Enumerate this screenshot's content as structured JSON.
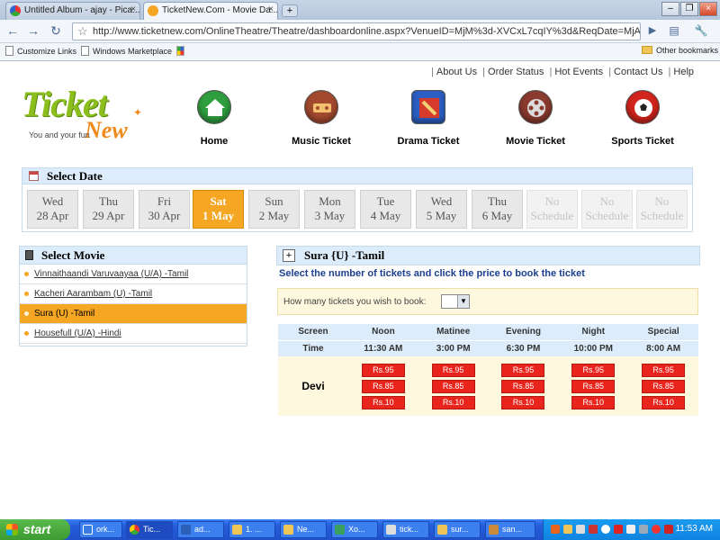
{
  "browser": {
    "tabs": [
      {
        "label": "Untitled Album - ajay - Pica...",
        "active": false
      },
      {
        "label": "TicketNew.Com - Movie Da...",
        "active": true
      }
    ],
    "new_tab": "+",
    "url": "http://www.ticketnew.com/OnlineTheatre/Theatre/dashboardonline.aspx?VenueID=MjM%3d-XVCxL7cqIY%3d&ReqDate=MjA>",
    "bookmarks": [
      "Customize Links",
      "Windows Marketplace"
    ],
    "other_bookmarks": "Other bookmarks"
  },
  "site": {
    "top_links": [
      "About Us",
      "Order Status",
      "Hot Events",
      "Contact Us",
      "Help"
    ],
    "logo_text": "Ticket",
    "logo_sub": "New",
    "tagline": "You and your fun",
    "categories": [
      {
        "label": "Home",
        "icon": "home-icon",
        "color": "#2e9e3e"
      },
      {
        "label": "Music Ticket",
        "icon": "music-icon",
        "color": "#a34a2e"
      },
      {
        "label": "Drama Ticket",
        "icon": "drama-icon",
        "color": "#2c5fc4"
      },
      {
        "label": "Movie Ticket",
        "icon": "film-reel-icon",
        "color": "#8a3a2e"
      },
      {
        "label": "Sports Ticket",
        "icon": "football-icon",
        "color": "#d0241c"
      }
    ]
  },
  "select_date": {
    "title": "Select Date",
    "days": [
      {
        "day": "Wed",
        "date": "28 Apr",
        "state": "normal"
      },
      {
        "day": "Thu",
        "date": "29 Apr",
        "state": "normal"
      },
      {
        "day": "Fri",
        "date": "30 Apr",
        "state": "normal"
      },
      {
        "day": "Sat",
        "date": "1 May",
        "state": "selected"
      },
      {
        "day": "Sun",
        "date": "2 May",
        "state": "normal"
      },
      {
        "day": "Mon",
        "date": "3 May",
        "state": "normal"
      },
      {
        "day": "Tue",
        "date": "4 May",
        "state": "normal"
      },
      {
        "day": "Wed",
        "date": "5 May",
        "state": "normal"
      },
      {
        "day": "Thu",
        "date": "6 May",
        "state": "normal"
      },
      {
        "day": "No",
        "date": "Schedule",
        "state": "disabled"
      },
      {
        "day": "No",
        "date": "Schedule",
        "state": "disabled"
      },
      {
        "day": "No",
        "date": "Schedule",
        "state": "disabled"
      }
    ]
  },
  "select_movie": {
    "title": "Select Movie",
    "movies": [
      {
        "label": "Vinnaithaandi Varuvaayaa (U/A) -Tamil",
        "selected": false
      },
      {
        "label": "Kacheri Aarambam (U) -Tamil",
        "selected": false
      },
      {
        "label": "Sura (U) -Tamil",
        "selected": true
      },
      {
        "label": "Housefull (U/A) -Hindi",
        "selected": false
      }
    ]
  },
  "booking": {
    "movie_title": "Sura {U} -Tamil",
    "expand_symbol": "+",
    "instruction": "Select the number of tickets and click the price to book the ticket",
    "tickets_label": "How many tickets you wish to book:",
    "tickets_value": "",
    "screen_header": "Screen",
    "time_header": "Time",
    "shows": [
      {
        "name": "Noon",
        "time": "11:30 AM"
      },
      {
        "name": "Matinee",
        "time": "3:00 PM"
      },
      {
        "name": "Evening",
        "time": "6:30 PM"
      },
      {
        "name": "Night",
        "time": "10:00 PM"
      },
      {
        "name": "Special",
        "time": "8:00 AM"
      }
    ],
    "screen_name": "Devi",
    "prices": [
      "Rs.95",
      "Rs.85",
      "Rs.10"
    ]
  },
  "taskbar": {
    "start": "start",
    "items": [
      "ork...",
      "Tic...",
      "ad...",
      "1. ...",
      "Ne...",
      "Xo...",
      "tick...",
      "sur...",
      "san..."
    ],
    "active_index": 1,
    "clock": "11:53 AM"
  },
  "colors": {
    "accent_orange": "#f5a623",
    "price_red": "#e8241c",
    "panel_blue": "#ddecfb",
    "instruction_blue": "#1c3f8f"
  }
}
